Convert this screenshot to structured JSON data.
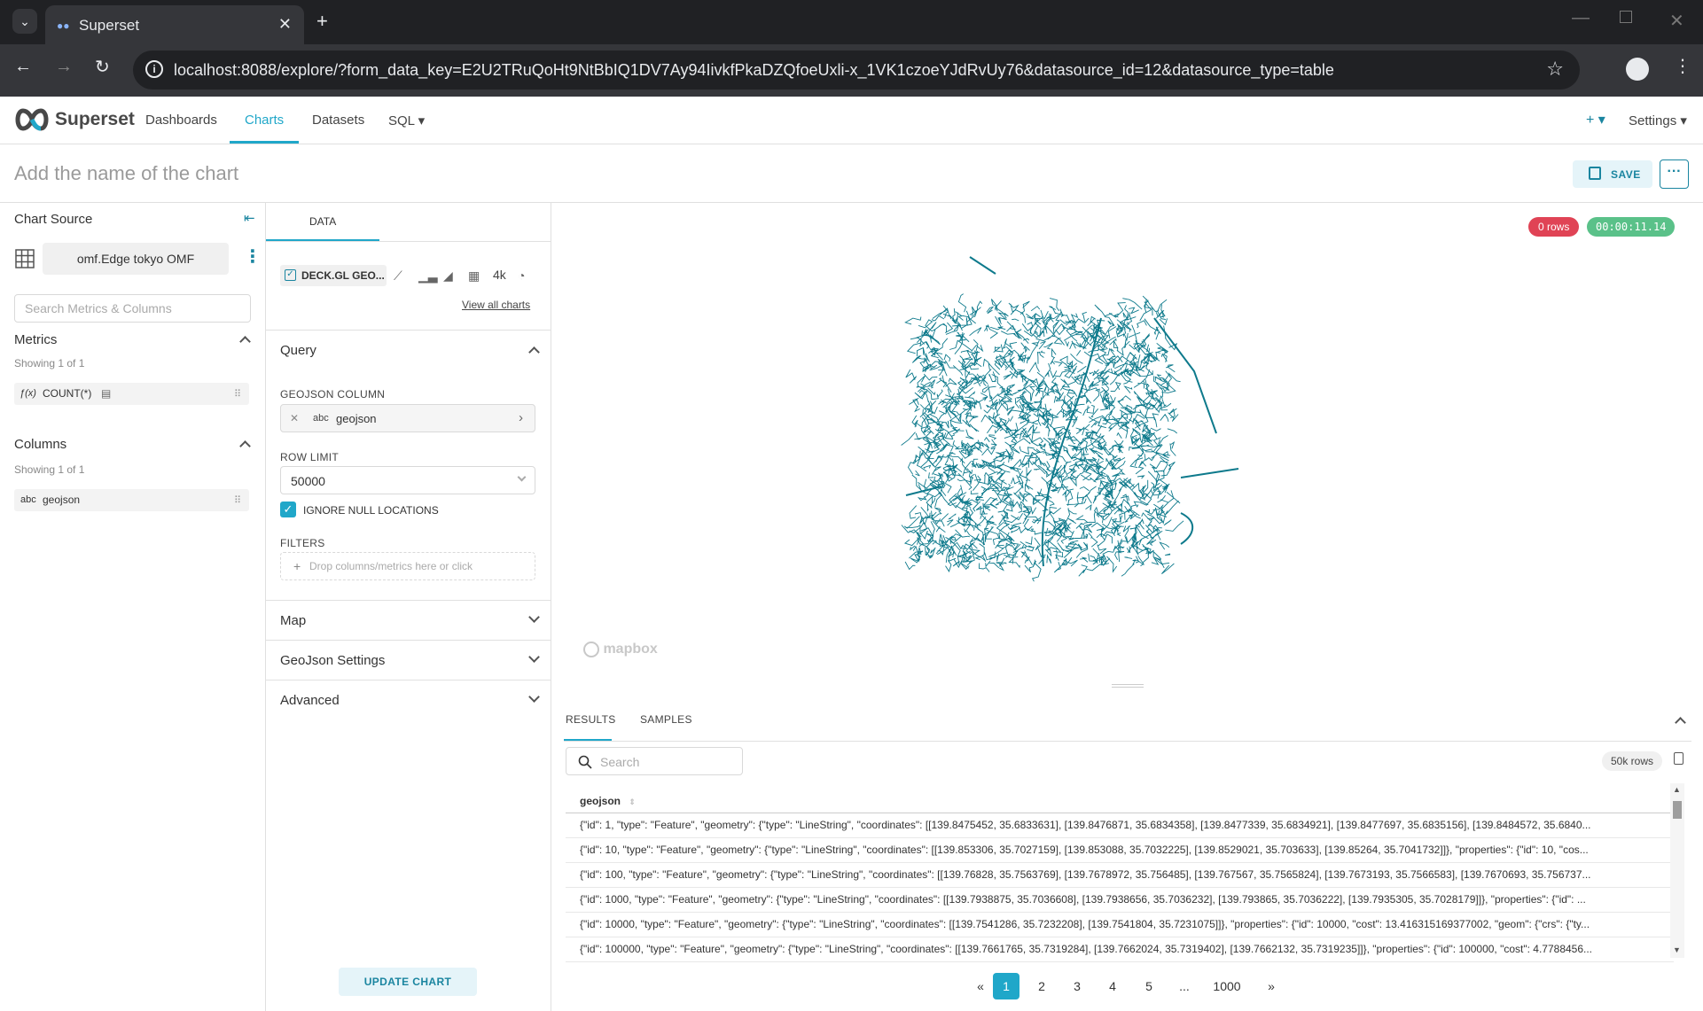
{
  "browser": {
    "tab_title": "Superset",
    "url": "localhost:8088/explore/?form_data_key=E2U2TRuQoHt9NtBbIQ1DV7Ay94IivkfPkaDZQfoeUxli-x_1VK1czoeYJdRvUy76&datasource_id=12&datasource_type=table"
  },
  "nav": {
    "brand": "Superset",
    "links": [
      "Dashboards",
      "Charts",
      "Datasets",
      "SQL ▾"
    ],
    "plus": "+ ▾",
    "settings": "Settings ▾"
  },
  "header": {
    "chart_name_placeholder": "Add the name of the chart",
    "save_label": "SAVE",
    "more_label": "···"
  },
  "left": {
    "chart_source_label": "Chart Source",
    "datasource": "omf.Edge tokyo OMF",
    "search_placeholder": "Search Metrics & Columns",
    "metrics": {
      "title": "Metrics",
      "showing": "Showing 1 of 1",
      "items": [
        {
          "prefix": "ƒ(x)",
          "label": "COUNT(*)"
        }
      ]
    },
    "columns": {
      "title": "Columns",
      "showing": "Showing 1 of 1",
      "items": [
        {
          "prefix": "abc",
          "label": "geojson"
        }
      ]
    }
  },
  "mid": {
    "tab": "DATA",
    "viz_selected": "DECK.GL GEO...",
    "viz_more": "4k",
    "view_all": "View all charts",
    "query_title": "Query",
    "geojson_label": "GEOJSON COLUMN",
    "geojson_value": "geojson",
    "geojson_type": "abc",
    "row_limit_label": "ROW LIMIT",
    "row_limit_value": "50000",
    "ignore_null_label": "IGNORE NULL LOCATIONS",
    "filters_label": "FILTERS",
    "filters_placeholder": "Drop columns/metrics here or click",
    "sections": [
      "Map",
      "GeoJson Settings",
      "Advanced"
    ],
    "update_label": "UPDATE CHART"
  },
  "right": {
    "rows_badge": "0 rows",
    "time_badge": "00:00:11.14",
    "mapbox_label": "mapbox",
    "tabs": [
      "RESULTS",
      "SAMPLES"
    ],
    "search_placeholder": "Search",
    "row_count": "50k rows",
    "column_header": "geojson",
    "rows": [
      "{\"id\": 1, \"type\": \"Feature\", \"geometry\": {\"type\": \"LineString\", \"coordinates\": [[139.8475452, 35.6833631], [139.8476871, 35.6834358], [139.8477339, 35.6834921], [139.8477697, 35.6835156], [139.8484572, 35.6840...",
      "{\"id\": 10, \"type\": \"Feature\", \"geometry\": {\"type\": \"LineString\", \"coordinates\": [[139.853306, 35.7027159], [139.853088, 35.7032225], [139.8529021, 35.703633], [139.85264, 35.7041732]]}, \"properties\": {\"id\": 10, \"cos...",
      "{\"id\": 100, \"type\": \"Feature\", \"geometry\": {\"type\": \"LineString\", \"coordinates\": [[139.76828, 35.7563769], [139.7678972, 35.756485], [139.767567, 35.7565824], [139.7673193, 35.7566583], [139.7670693, 35.756737...",
      "{\"id\": 1000, \"type\": \"Feature\", \"geometry\": {\"type\": \"LineString\", \"coordinates\": [[139.7938875, 35.7036608], [139.7938656, 35.7036232], [139.793865, 35.7036222], [139.7935305, 35.7028179]]}, \"properties\": {\"id\": ...",
      "{\"id\": 10000, \"type\": \"Feature\", \"geometry\": {\"type\": \"LineString\", \"coordinates\": [[139.7541286, 35.7232208], [139.7541804, 35.7231075]]}, \"properties\": {\"id\": 10000, \"cost\": 13.416315169377002, \"geom\": {\"crs\": {\"ty...",
      "{\"id\": 100000, \"type\": \"Feature\", \"geometry\": {\"type\": \"LineString\", \"coordinates\": [[139.7661765, 35.7319284], [139.7662024, 35.7319402], [139.7662132, 35.7319235]]}, \"properties\": {\"id\": 100000, \"cost\": 4.7788456..."
    ],
    "pagination": [
      "«",
      "1",
      "2",
      "3",
      "4",
      "5",
      "...",
      "1000",
      "»"
    ],
    "active_page": "1"
  },
  "colors": {
    "accent": "#20a7c9",
    "map_lines": "#0e7a8c",
    "error": "#e04355",
    "success": "#5ac189"
  }
}
